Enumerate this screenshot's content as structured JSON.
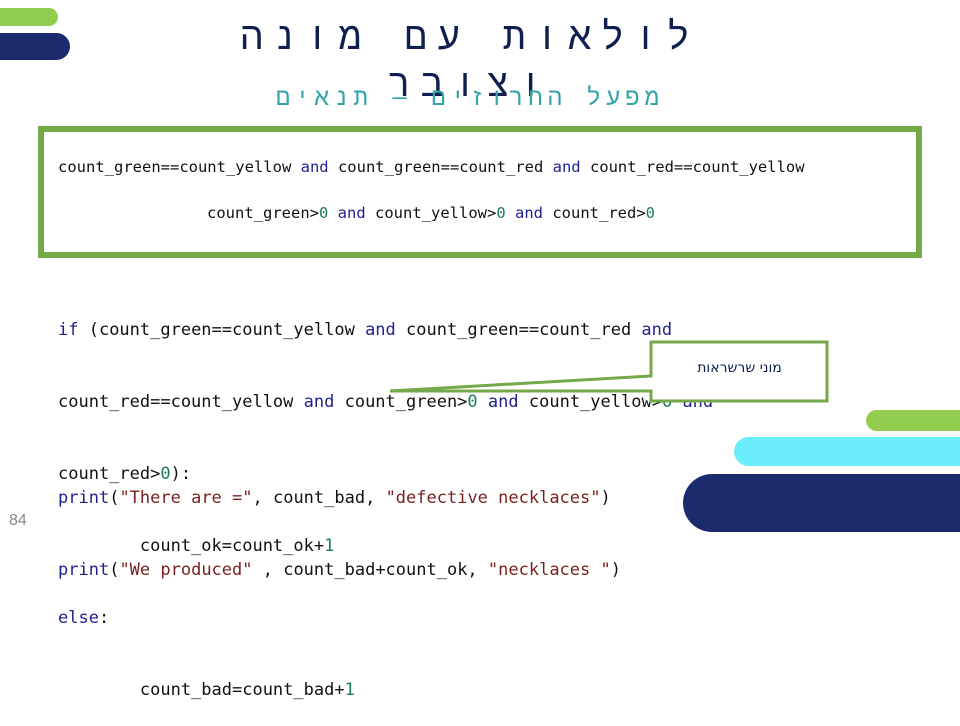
{
  "slide": {
    "title": "לולאות עם מונה וצובר",
    "subtitle": "מפעל החרוזים – תנאים",
    "page_number": "84"
  },
  "colors": {
    "navy": "#1c2a6e",
    "green": "#92cd50",
    "cyan": "#6cedfb",
    "box_border": "#74a84a",
    "subtitle": "#34a3a8",
    "keyword": "#1f1f8f",
    "number": "#1b7a5a",
    "string": "#7a1f1f"
  },
  "conditions_box": {
    "line1": [
      {
        "t": "count_green==count_yellow ",
        "c": "plain"
      },
      {
        "t": "and",
        "c": "kw"
      },
      {
        "t": " count_green==count_red ",
        "c": "plain"
      },
      {
        "t": "and",
        "c": "kw"
      },
      {
        "t": " count_red==count_yellow",
        "c": "plain"
      }
    ],
    "line2": [
      {
        "t": "count_green>",
        "c": "plain"
      },
      {
        "t": "0",
        "c": "num"
      },
      {
        "t": " ",
        "c": "plain"
      },
      {
        "t": "and",
        "c": "kw"
      },
      {
        "t": " count_yellow>",
        "c": "plain"
      },
      {
        "t": "0",
        "c": "num"
      },
      {
        "t": " ",
        "c": "plain"
      },
      {
        "t": "and",
        "c": "kw"
      },
      {
        "t": " count_red>",
        "c": "plain"
      },
      {
        "t": "0",
        "c": "num"
      }
    ]
  },
  "code": {
    "lines": [
      [
        {
          "t": "if",
          "c": "kw"
        },
        {
          "t": " (count_green==count_yellow ",
          "c": "plain"
        },
        {
          "t": "and",
          "c": "kw"
        },
        {
          "t": " count_green==count_red ",
          "c": "plain"
        },
        {
          "t": "and",
          "c": "kw"
        }
      ],
      [
        {
          "t": "count_red==count_yellow ",
          "c": "plain"
        },
        {
          "t": "and",
          "c": "kw"
        },
        {
          "t": " count_green>",
          "c": "plain"
        },
        {
          "t": "0",
          "c": "num"
        },
        {
          "t": " ",
          "c": "plain"
        },
        {
          "t": "and",
          "c": "kw"
        },
        {
          "t": " count_yellow>",
          "c": "plain"
        },
        {
          "t": "0",
          "c": "num"
        },
        {
          "t": " ",
          "c": "plain"
        },
        {
          "t": "and",
          "c": "kw"
        }
      ],
      [
        {
          "t": "count_red>",
          "c": "plain"
        },
        {
          "t": "0",
          "c": "num"
        },
        {
          "t": "):",
          "c": "plain"
        }
      ],
      [
        {
          "t": "        count_ok=count_ok+",
          "c": "plain"
        },
        {
          "t": "1",
          "c": "num"
        }
      ],
      [
        {
          "t": "else",
          "c": "kw"
        },
        {
          "t": ":",
          "c": "plain"
        }
      ],
      [
        {
          "t": "        count_bad=count_bad+",
          "c": "plain"
        },
        {
          "t": "1",
          "c": "num"
        }
      ]
    ],
    "print_lines": [
      [
        {
          "t": "print",
          "c": "fn"
        },
        {
          "t": "(",
          "c": "plain"
        },
        {
          "t": "\"There are =\"",
          "c": "str"
        },
        {
          "t": ", count_bad, ",
          "c": "plain"
        },
        {
          "t": "\"defective necklaces\"",
          "c": "str"
        },
        {
          "t": ")",
          "c": "plain"
        }
      ],
      [
        {
          "t": "print",
          "c": "fn"
        },
        {
          "t": "(",
          "c": "plain"
        },
        {
          "t": "\"We produced\"",
          "c": "str"
        },
        {
          "t": " , count_bad+count_ok, ",
          "c": "plain"
        },
        {
          "t": "\"necklaces \"",
          "c": "str"
        },
        {
          "t": ")",
          "c": "plain"
        }
      ]
    ]
  },
  "callout": {
    "text": "מוני שרשראות"
  }
}
